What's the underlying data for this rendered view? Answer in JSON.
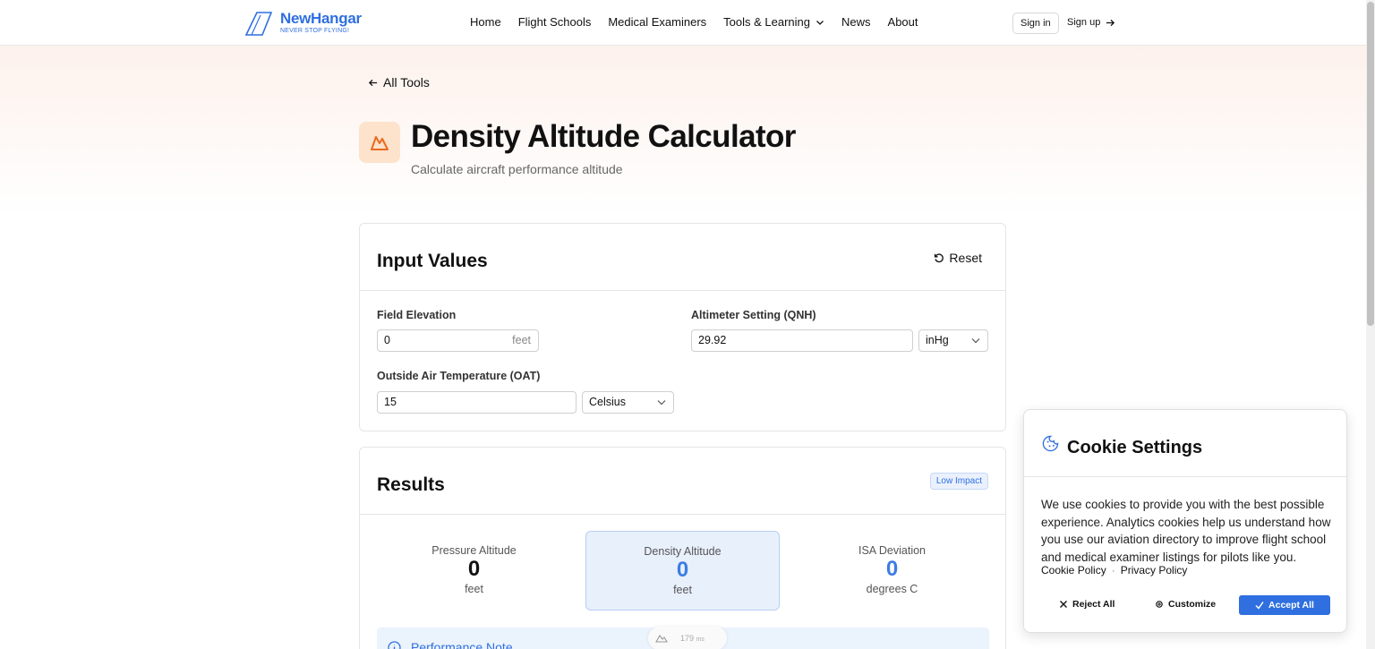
{
  "brand": {
    "name": "NewHangar",
    "tagline": "NEVER STOP FLYING!",
    "color": "#2f6fe0"
  },
  "nav": {
    "items": [
      {
        "label": "Home"
      },
      {
        "label": "Flight Schools"
      },
      {
        "label": "Medical Examiners"
      },
      {
        "label": "Tools & Learning",
        "icon": "chevron-down-icon"
      },
      {
        "label": "News"
      },
      {
        "label": "About"
      }
    ],
    "signin": "Sign in",
    "signup": "Sign up"
  },
  "page": {
    "back_label": "All Tools",
    "title": "Density Altitude Calculator",
    "subtitle": "Calculate aircraft performance altitude",
    "tool_icon": "mountain-icon"
  },
  "inputs": {
    "title": "Input Values",
    "reset_label": "Reset",
    "field_elevation": {
      "label": "Field Elevation",
      "value": "0",
      "unit": "feet"
    },
    "altimeter": {
      "label": "Altimeter Setting (QNH)",
      "value": "29.92",
      "unit_selected": "inHg"
    },
    "oat": {
      "label": "Outside Air Temperature (OAT)",
      "value": "15",
      "unit_selected": "Celsius"
    }
  },
  "results": {
    "title": "Results",
    "badge": "Low Impact",
    "pressure_altitude": {
      "label": "Pressure Altitude",
      "value": "0",
      "unit": "feet"
    },
    "density_altitude": {
      "label": "Density Altitude",
      "value": "0",
      "unit": "feet"
    },
    "isa_deviation": {
      "label": "ISA Deviation",
      "value": "0",
      "unit": "degrees C"
    },
    "note_title": "Performance Note"
  },
  "float_pill": {
    "value": "179",
    "unit": "ms"
  },
  "cookie": {
    "title": "Cookie Settings",
    "body": "We use cookies to provide you with the best possible experience. Analytics cookies help us understand how you use our aviation directory to improve flight school and medical examiner listings for pilots like you.",
    "links": [
      "Cookie Policy",
      "Privacy Policy"
    ],
    "reject": "Reject All",
    "customize": "Customize",
    "accept": "Accept All",
    "accent": "#2f6fe0"
  }
}
